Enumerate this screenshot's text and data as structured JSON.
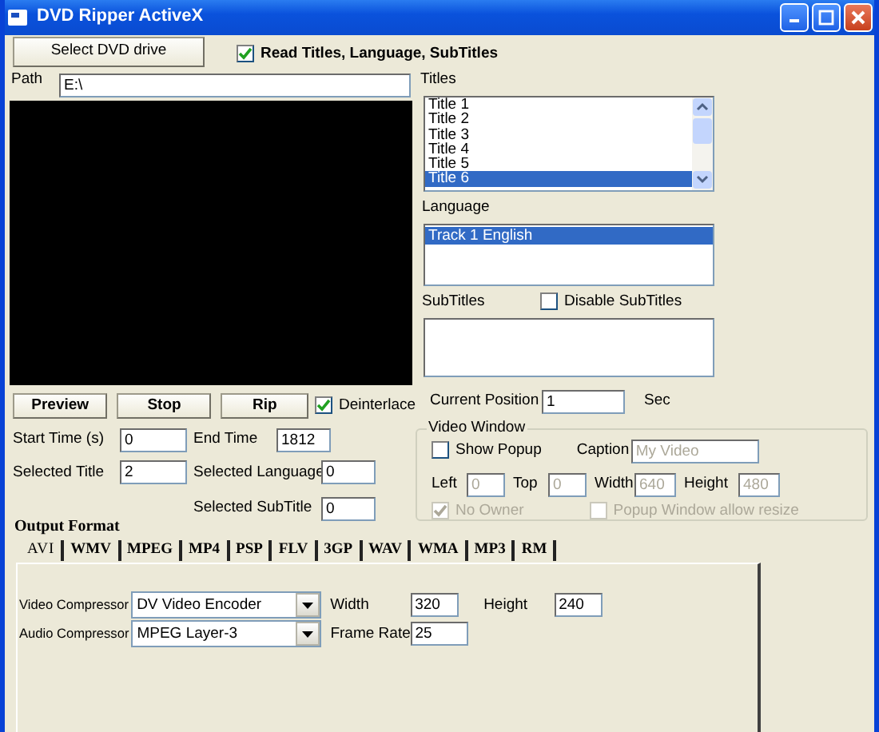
{
  "window": {
    "title": "DVD Ripper ActiveX"
  },
  "select_drive_button": "Select DVD drive",
  "read_titles": {
    "label": "Read Titles, Language, SubTitles",
    "checked": true
  },
  "path": {
    "label": "Path",
    "value": "E:\\"
  },
  "titles": {
    "label": "Titles",
    "items": [
      {
        "label": "Title 1",
        "selected": false
      },
      {
        "label": "Title 2",
        "selected": false
      },
      {
        "label": "Title 3",
        "selected": false
      },
      {
        "label": "Title 4",
        "selected": false
      },
      {
        "label": "Title 5",
        "selected": false
      },
      {
        "label": "Title 6",
        "selected": true
      }
    ]
  },
  "language": {
    "label": "Language",
    "items": [
      {
        "label": "Track 1 English",
        "selected": true
      }
    ]
  },
  "subtitles": {
    "label": "SubTitles",
    "disable": {
      "label": "Disable SubTitles",
      "checked": false
    }
  },
  "playback_buttons": [
    "Preview",
    "Stop",
    "Rip"
  ],
  "deinterlace": {
    "label": "Deinterlace",
    "checked": true
  },
  "start_time": {
    "label": "Start Time (s)",
    "value": "0"
  },
  "end_time": {
    "label": "End Time",
    "value": "1812"
  },
  "selected_title": {
    "label": "Selected Title",
    "value": "2"
  },
  "selected_language": {
    "label": "Selected Language",
    "value": "0"
  },
  "selected_subtitle": {
    "label": "Selected SubTitle",
    "value": "0"
  },
  "current_position": {
    "label": "Current Position",
    "value": "1",
    "unit": "Sec"
  },
  "video_window": {
    "title": "Video Window",
    "show_popup": {
      "label": "Show Popup",
      "checked": false,
      "disabled": false
    },
    "caption": {
      "label": "Caption",
      "value": "My Video",
      "disabled": true
    },
    "geometry": [
      {
        "label": "Left",
        "value": "0",
        "disabled": true
      },
      {
        "label": "Top",
        "value": "0",
        "disabled": true
      },
      {
        "label": "Width",
        "value": "640",
        "disabled": true
      },
      {
        "label": "Height",
        "value": "480",
        "disabled": true
      }
    ],
    "no_owner": {
      "label": "No Owner",
      "checked": true,
      "disabled": true
    },
    "allow_resize": {
      "label": "Popup Window allow resize",
      "checked": false,
      "disabled": true
    }
  },
  "output_format": {
    "label": "Output Format",
    "tabs": [
      {
        "label": "AVI",
        "selected": true
      },
      {
        "label": "WMV",
        "selected": false
      },
      {
        "label": "MPEG",
        "selected": false
      },
      {
        "label": "MP4",
        "selected": false
      },
      {
        "label": "PSP",
        "selected": false
      },
      {
        "label": "FLV",
        "selected": false
      },
      {
        "label": "3GP",
        "selected": false
      },
      {
        "label": "WAV",
        "selected": false
      },
      {
        "label": "WMA",
        "selected": false
      },
      {
        "label": "MP3",
        "selected": false
      },
      {
        "label": "RM",
        "selected": false
      }
    ],
    "video_compressor": {
      "label": "Video Compressor",
      "value": "DV Video Encoder"
    },
    "audio_compressor": {
      "label": "Audio Compressor",
      "value": "MPEG Layer-3"
    },
    "width": {
      "label": "Width",
      "value": "320"
    },
    "height": {
      "label": "Height",
      "value": "240"
    },
    "frame_rate": {
      "label": "Frame Rate",
      "value": "25"
    }
  }
}
